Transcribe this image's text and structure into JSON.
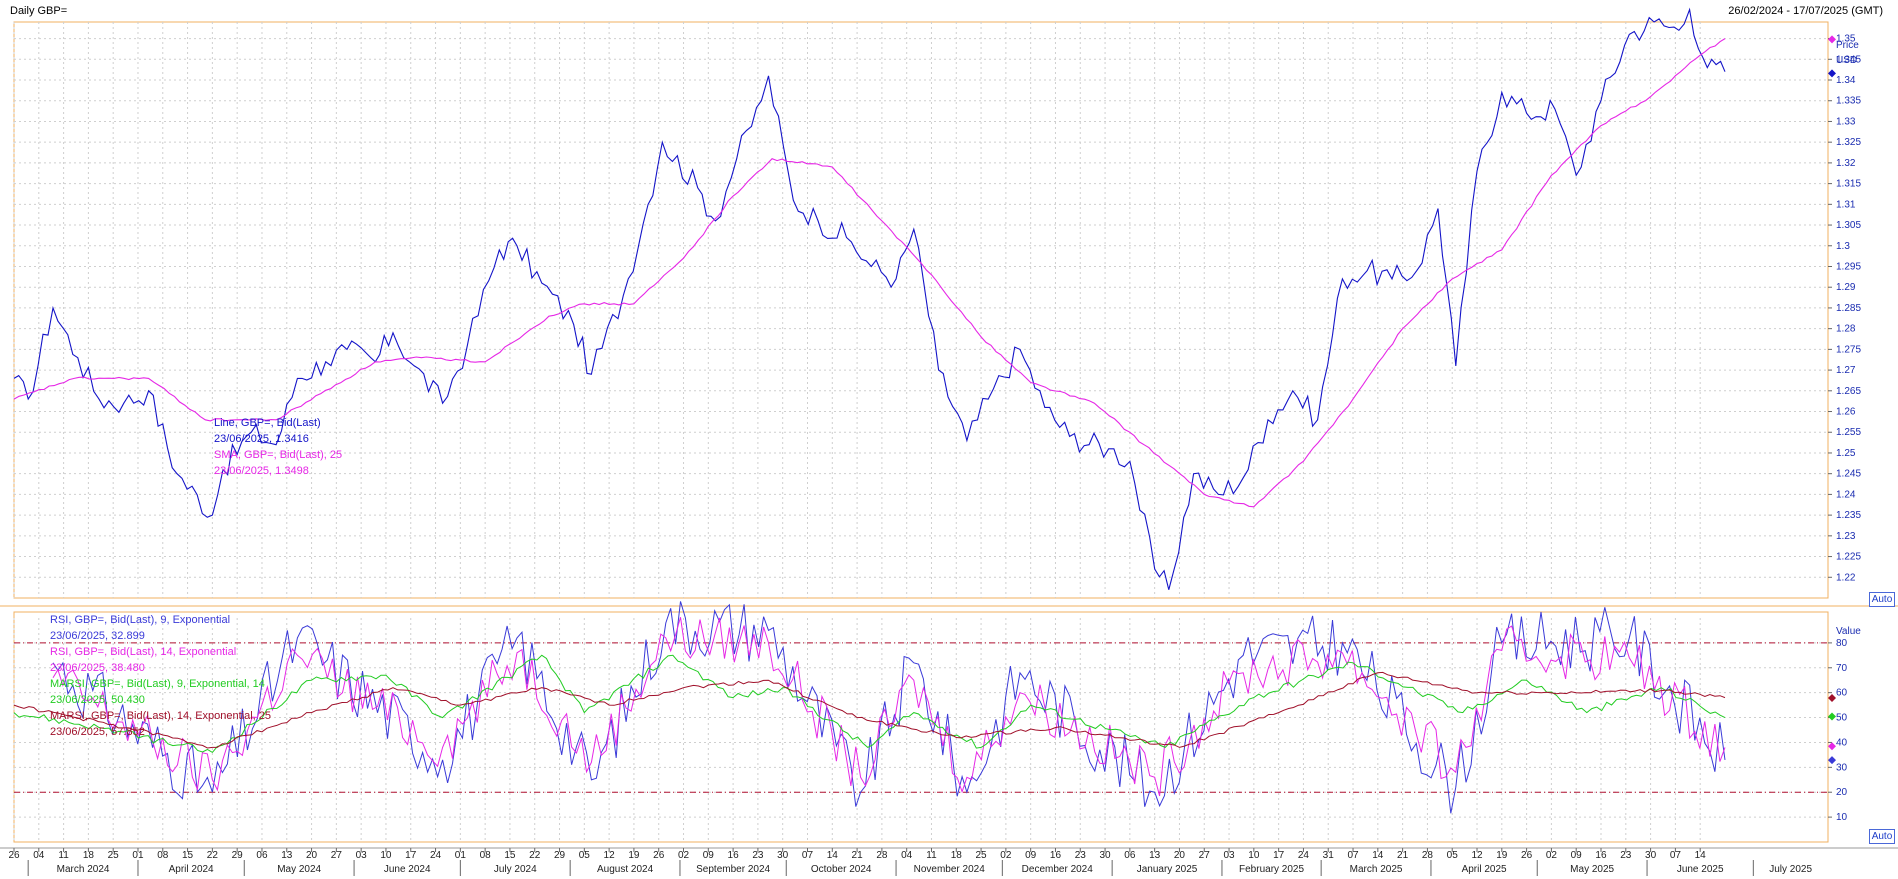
{
  "window": {
    "title": "Daily GBP=",
    "date_range": "26/02/2024 - 17/07/2025 (GMT)"
  },
  "colors": {
    "price_line": "#1414c8",
    "sma_line": "#e628e6",
    "rsi9": "#3a3ad8",
    "rsi14": "#e628e6",
    "marsi9": "#22cc22",
    "marsi14": "#a0102a",
    "grid": "#cfcfcf",
    "frame": "#f0b060",
    "level_line": "#b01030"
  },
  "price_panel": {
    "axis_title": "Price",
    "axis_unit": "USD",
    "ticks": [
      "1.35",
      "1.345",
      "1.34",
      "1.335",
      "1.33",
      "1.325",
      "1.32",
      "1.315",
      "1.31",
      "1.305",
      "1.3",
      "1.295",
      "1.29",
      "1.285",
      "1.28",
      "1.275",
      "1.27",
      "1.265",
      "1.26",
      "1.255",
      "1.25",
      "1.245",
      "1.24",
      "1.235",
      "1.23",
      "1.225",
      "1.22"
    ],
    "legend": [
      {
        "label": "Line, GBP=, Bid(Last)",
        "value": "23/06/2025, 1.3416"
      },
      {
        "label": "SMA, GBP=, Bid(Last),  25",
        "value": "23/06/2025, 1.3498"
      }
    ],
    "auto_label": "Auto"
  },
  "indicator_panel": {
    "axis_title": "Value",
    "ticks": [
      "80",
      "70",
      "60",
      "50",
      "40",
      "30",
      "20",
      "10"
    ],
    "legend": [
      {
        "label": "RSI, GBP=, Bid(Last),  9, Exponential",
        "value": "23/06/2025, 32.899"
      },
      {
        "label": "RSI, GBP=, Bid(Last),  14, Exponential",
        "value": "23/06/2025, 38.480"
      },
      {
        "label": "MARSI, GBP=, Bid(Last),  9, Exponential, 14",
        "value": "23/06/2025, 50.430"
      },
      {
        "label": "MARSI, GBP=, Bid(Last),  14, Exponential, 25",
        "value": "23/06/2025, 57.852"
      }
    ],
    "auto_label": "Auto"
  },
  "x_axis": {
    "day_ticks": [
      "26",
      "04",
      "11",
      "18",
      "25",
      "01",
      "08",
      "15",
      "22",
      "29",
      "06",
      "13",
      "20",
      "27",
      "03",
      "10",
      "17",
      "24",
      "01",
      "08",
      "15",
      "22",
      "29",
      "05",
      "12",
      "19",
      "26",
      "02",
      "09",
      "16",
      "23",
      "30",
      "07",
      "14",
      "21",
      "28",
      "04",
      "11",
      "18",
      "25",
      "02",
      "09",
      "16",
      "23",
      "30",
      "06",
      "13",
      "20",
      "27",
      "03",
      "10",
      "17",
      "24",
      "31",
      "07",
      "14",
      "21",
      "28",
      "05",
      "12",
      "19",
      "26",
      "02",
      "09",
      "16",
      "23",
      "30",
      "07",
      "14"
    ],
    "month_labels": [
      "March 2024",
      "April 2024",
      "May 2024",
      "June 2024",
      "July 2024",
      "August 2024",
      "September 2024",
      "October 2024",
      "November 2024",
      "December 2024",
      "January 2025",
      "February 2025",
      "March 2025",
      "April 2025",
      "May 2025",
      "June 2025",
      "July 2025"
    ]
  },
  "chart_data": [
    {
      "type": "line",
      "x_range": [
        "2024-02-26",
        "2025-07-17"
      ],
      "ylim": [
        1.215,
        1.354
      ],
      "series": [
        {
          "name": "Line, GBP=, Bid(Last)",
          "key_points": [
            [
              "2024-02-26",
              1.268
            ],
            [
              "2024-03-01",
              1.263
            ],
            [
              "2024-03-08",
              1.285
            ],
            [
              "2024-03-15",
              1.273
            ],
            [
              "2024-03-21",
              1.263
            ],
            [
              "2024-03-28",
              1.262
            ],
            [
              "2024-04-04",
              1.265
            ],
            [
              "2024-04-12",
              1.245
            ],
            [
              "2024-04-22",
              1.235
            ],
            [
              "2024-04-25",
              1.246
            ],
            [
              "2024-05-03",
              1.255
            ],
            [
              "2024-05-10",
              1.252
            ],
            [
              "2024-05-16",
              1.268
            ],
            [
              "2024-05-24",
              1.272
            ],
            [
              "2024-05-30",
              1.275
            ],
            [
              "2024-06-07",
              1.272
            ],
            [
              "2024-06-12",
              1.279
            ],
            [
              "2024-06-18",
              1.271
            ],
            [
              "2024-06-26",
              1.262
            ],
            [
              "2024-07-03",
              1.276
            ],
            [
              "2024-07-12",
              1.299
            ],
            [
              "2024-07-17",
              1.3
            ],
            [
              "2024-07-24",
              1.291
            ],
            [
              "2024-08-02",
              1.281
            ],
            [
              "2024-08-07",
              1.269
            ],
            [
              "2024-08-16",
              1.288
            ],
            [
              "2024-08-23",
              1.31
            ],
            [
              "2024-08-27",
              1.325
            ],
            [
              "2024-09-06",
              1.314
            ],
            [
              "2024-09-11",
              1.306
            ],
            [
              "2024-09-17",
              1.321
            ],
            [
              "2024-09-24",
              1.335
            ],
            [
              "2024-09-26",
              1.341
            ],
            [
              "2024-10-03",
              1.311
            ],
            [
              "2024-10-10",
              1.306
            ],
            [
              "2024-10-18",
              1.302
            ],
            [
              "2024-10-25",
              1.295
            ],
            [
              "2024-11-01",
              1.292
            ],
            [
              "2024-11-06",
              1.304
            ],
            [
              "2024-11-13",
              1.27
            ],
            [
              "2024-11-21",
              1.253
            ],
            [
              "2024-11-27",
              1.263
            ],
            [
              "2024-12-06",
              1.275
            ],
            [
              "2024-12-13",
              1.261
            ],
            [
              "2024-12-20",
              1.254
            ],
            [
              "2024-12-31",
              1.251
            ],
            [
              "2025-01-06",
              1.248
            ],
            [
              "2025-01-13",
              1.222
            ],
            [
              "2025-01-17",
              1.217
            ],
            [
              "2025-01-24",
              1.245
            ],
            [
              "2025-01-31",
              1.24
            ],
            [
              "2025-02-07",
              1.244
            ],
            [
              "2025-02-14",
              1.258
            ],
            [
              "2025-02-21",
              1.265
            ],
            [
              "2025-02-28",
              1.258
            ],
            [
              "2025-03-07",
              1.292
            ],
            [
              "2025-03-14",
              1.294
            ],
            [
              "2025-03-21",
              1.292
            ],
            [
              "2025-03-28",
              1.294
            ],
            [
              "2025-04-03",
              1.309
            ],
            [
              "2025-04-08",
              1.271
            ],
            [
              "2025-04-14",
              1.318
            ],
            [
              "2025-04-21",
              1.337
            ],
            [
              "2025-04-28",
              1.332
            ],
            [
              "2025-05-06",
              1.333
            ],
            [
              "2025-05-12",
              1.317
            ],
            [
              "2025-05-19",
              1.335
            ],
            [
              "2025-05-27",
              1.351
            ],
            [
              "2025-06-03",
              1.354
            ],
            [
              "2025-06-10",
              1.352
            ],
            [
              "2025-06-13",
              1.357
            ],
            [
              "2025-06-18",
              1.343
            ],
            [
              "2025-06-23",
              1.342
            ]
          ]
        },
        {
          "name": "SMA, GBP=, Bid(Last),  25",
          "key_points": [
            [
              "2024-02-26",
              1.263
            ],
            [
              "2024-03-14",
              1.268
            ],
            [
              "2024-04-04",
              1.268
            ],
            [
              "2024-04-20",
              1.258
            ],
            [
              "2024-05-10",
              1.258
            ],
            [
              "2024-06-07",
              1.272
            ],
            [
              "2024-06-20",
              1.273
            ],
            [
              "2024-07-08",
              1.272
            ],
            [
              "2024-07-26",
              1.283
            ],
            [
              "2024-08-05",
              1.286
            ],
            [
              "2024-08-19",
              1.286
            ],
            [
              "2024-09-02",
              1.297
            ],
            [
              "2024-09-16",
              1.312
            ],
            [
              "2024-09-27",
              1.321
            ],
            [
              "2024-10-14",
              1.319
            ],
            [
              "2024-10-28",
              1.306
            ],
            [
              "2024-11-11",
              1.293
            ],
            [
              "2024-11-25",
              1.278
            ],
            [
              "2024-12-09",
              1.267
            ],
            [
              "2024-12-27",
              1.262
            ],
            [
              "2025-01-10",
              1.252
            ],
            [
              "2025-01-27",
              1.24
            ],
            [
              "2025-02-10",
              1.237
            ],
            [
              "2025-02-24",
              1.248
            ],
            [
              "2025-03-10",
              1.263
            ],
            [
              "2025-03-24",
              1.28
            ],
            [
              "2025-04-07",
              1.292
            ],
            [
              "2025-04-21",
              1.299
            ],
            [
              "2025-05-05",
              1.317
            ],
            [
              "2025-05-19",
              1.329
            ],
            [
              "2025-06-02",
              1.336
            ],
            [
              "2025-06-16",
              1.346
            ],
            [
              "2025-06-23",
              1.35
            ]
          ]
        }
      ]
    },
    {
      "type": "line",
      "x_range": [
        "2024-02-26",
        "2025-07-17"
      ],
      "ylim": [
        0,
        90
      ],
      "reference_lines": [
        80,
        20
      ],
      "series": [
        {
          "name": "RSI, GBP=, Bid(Last),  9, Exponential",
          "key_points": [
            [
              "2024-03-08",
              72
            ],
            [
              "2024-04-22",
              20
            ],
            [
              "2024-05-16",
              82
            ],
            [
              "2024-06-26",
              33
            ],
            [
              "2024-07-17",
              82
            ],
            [
              "2024-08-07",
              25
            ],
            [
              "2024-08-28",
              88
            ],
            [
              "2024-09-26",
              85
            ],
            [
              "2024-10-22",
              20
            ],
            [
              "2024-11-06",
              72
            ],
            [
              "2024-11-21",
              20
            ],
            [
              "2024-12-06",
              68
            ],
            [
              "2025-01-13",
              20
            ],
            [
              "2025-02-07",
              75
            ],
            [
              "2025-03-07",
              80
            ],
            [
              "2025-04-08",
              22
            ],
            [
              "2025-04-21",
              80
            ],
            [
              "2025-05-27",
              82
            ],
            [
              "2025-06-23",
              33
            ]
          ]
        },
        {
          "name": "RSI, GBP=, Bid(Last),  14, Exponential",
          "key_points": [
            [
              "2024-03-08",
              66
            ],
            [
              "2024-04-22",
              25
            ],
            [
              "2024-05-16",
              75
            ],
            [
              "2024-06-26",
              38
            ],
            [
              "2024-07-17",
              76
            ],
            [
              "2024-08-07",
              32
            ],
            [
              "2024-08-28",
              82
            ],
            [
              "2024-09-26",
              80
            ],
            [
              "2024-10-22",
              26
            ],
            [
              "2024-11-06",
              65
            ],
            [
              "2024-11-21",
              26
            ],
            [
              "2024-12-06",
              60
            ],
            [
              "2025-01-13",
              26
            ],
            [
              "2025-02-07",
              68
            ],
            [
              "2025-03-07",
              76
            ],
            [
              "2025-04-08",
              28
            ],
            [
              "2025-04-21",
              77
            ],
            [
              "2025-05-27",
              74
            ],
            [
              "2025-06-23",
              38
            ]
          ]
        },
        {
          "name": "MARSI, GBP=, Bid(Last),  9, Exponential, 14",
          "key_points": [
            [
              "2024-02-26",
              52
            ],
            [
              "2024-03-21",
              46
            ],
            [
              "2024-04-22",
              36
            ],
            [
              "2024-05-20",
              65
            ],
            [
              "2024-06-10",
              67
            ],
            [
              "2024-06-26",
              50
            ],
            [
              "2024-07-24",
              75
            ],
            [
              "2024-08-05",
              52
            ],
            [
              "2024-08-30",
              75
            ],
            [
              "2024-09-16",
              58
            ],
            [
              "2024-09-30",
              62
            ],
            [
              "2024-10-24",
              38
            ],
            [
              "2024-11-06",
              52
            ],
            [
              "2024-11-25",
              38
            ],
            [
              "2024-12-09",
              55
            ],
            [
              "2025-01-16",
              38
            ],
            [
              "2025-02-10",
              58
            ],
            [
              "2025-03-10",
              72
            ],
            [
              "2025-04-10",
              52
            ],
            [
              "2025-04-28",
              65
            ],
            [
              "2025-05-15",
              52
            ],
            [
              "2025-06-05",
              62
            ],
            [
              "2025-06-23",
              50
            ]
          ]
        },
        {
          "name": "MARSI, GBP=, Bid(Last),  14, Exponential, 25",
          "key_points": [
            [
              "2024-02-26",
              55
            ],
            [
              "2024-04-01",
              45
            ],
            [
              "2024-04-22",
              38
            ],
            [
              "2024-05-20",
              52
            ],
            [
              "2024-06-12",
              62
            ],
            [
              "2024-07-01",
              55
            ],
            [
              "2024-07-24",
              62
            ],
            [
              "2024-08-12",
              55
            ],
            [
              "2024-09-02",
              62
            ],
            [
              "2024-09-26",
              65
            ],
            [
              "2024-10-21",
              50
            ],
            [
              "2024-11-18",
              42
            ],
            [
              "2024-12-16",
              46
            ],
            [
              "2025-01-20",
              38
            ],
            [
              "2025-02-17",
              52
            ],
            [
              "2025-03-17",
              68
            ],
            [
              "2025-04-14",
              60
            ],
            [
              "2025-05-12",
              60
            ],
            [
              "2025-06-06",
              61
            ],
            [
              "2025-06-23",
              58
            ]
          ]
        }
      ]
    }
  ]
}
